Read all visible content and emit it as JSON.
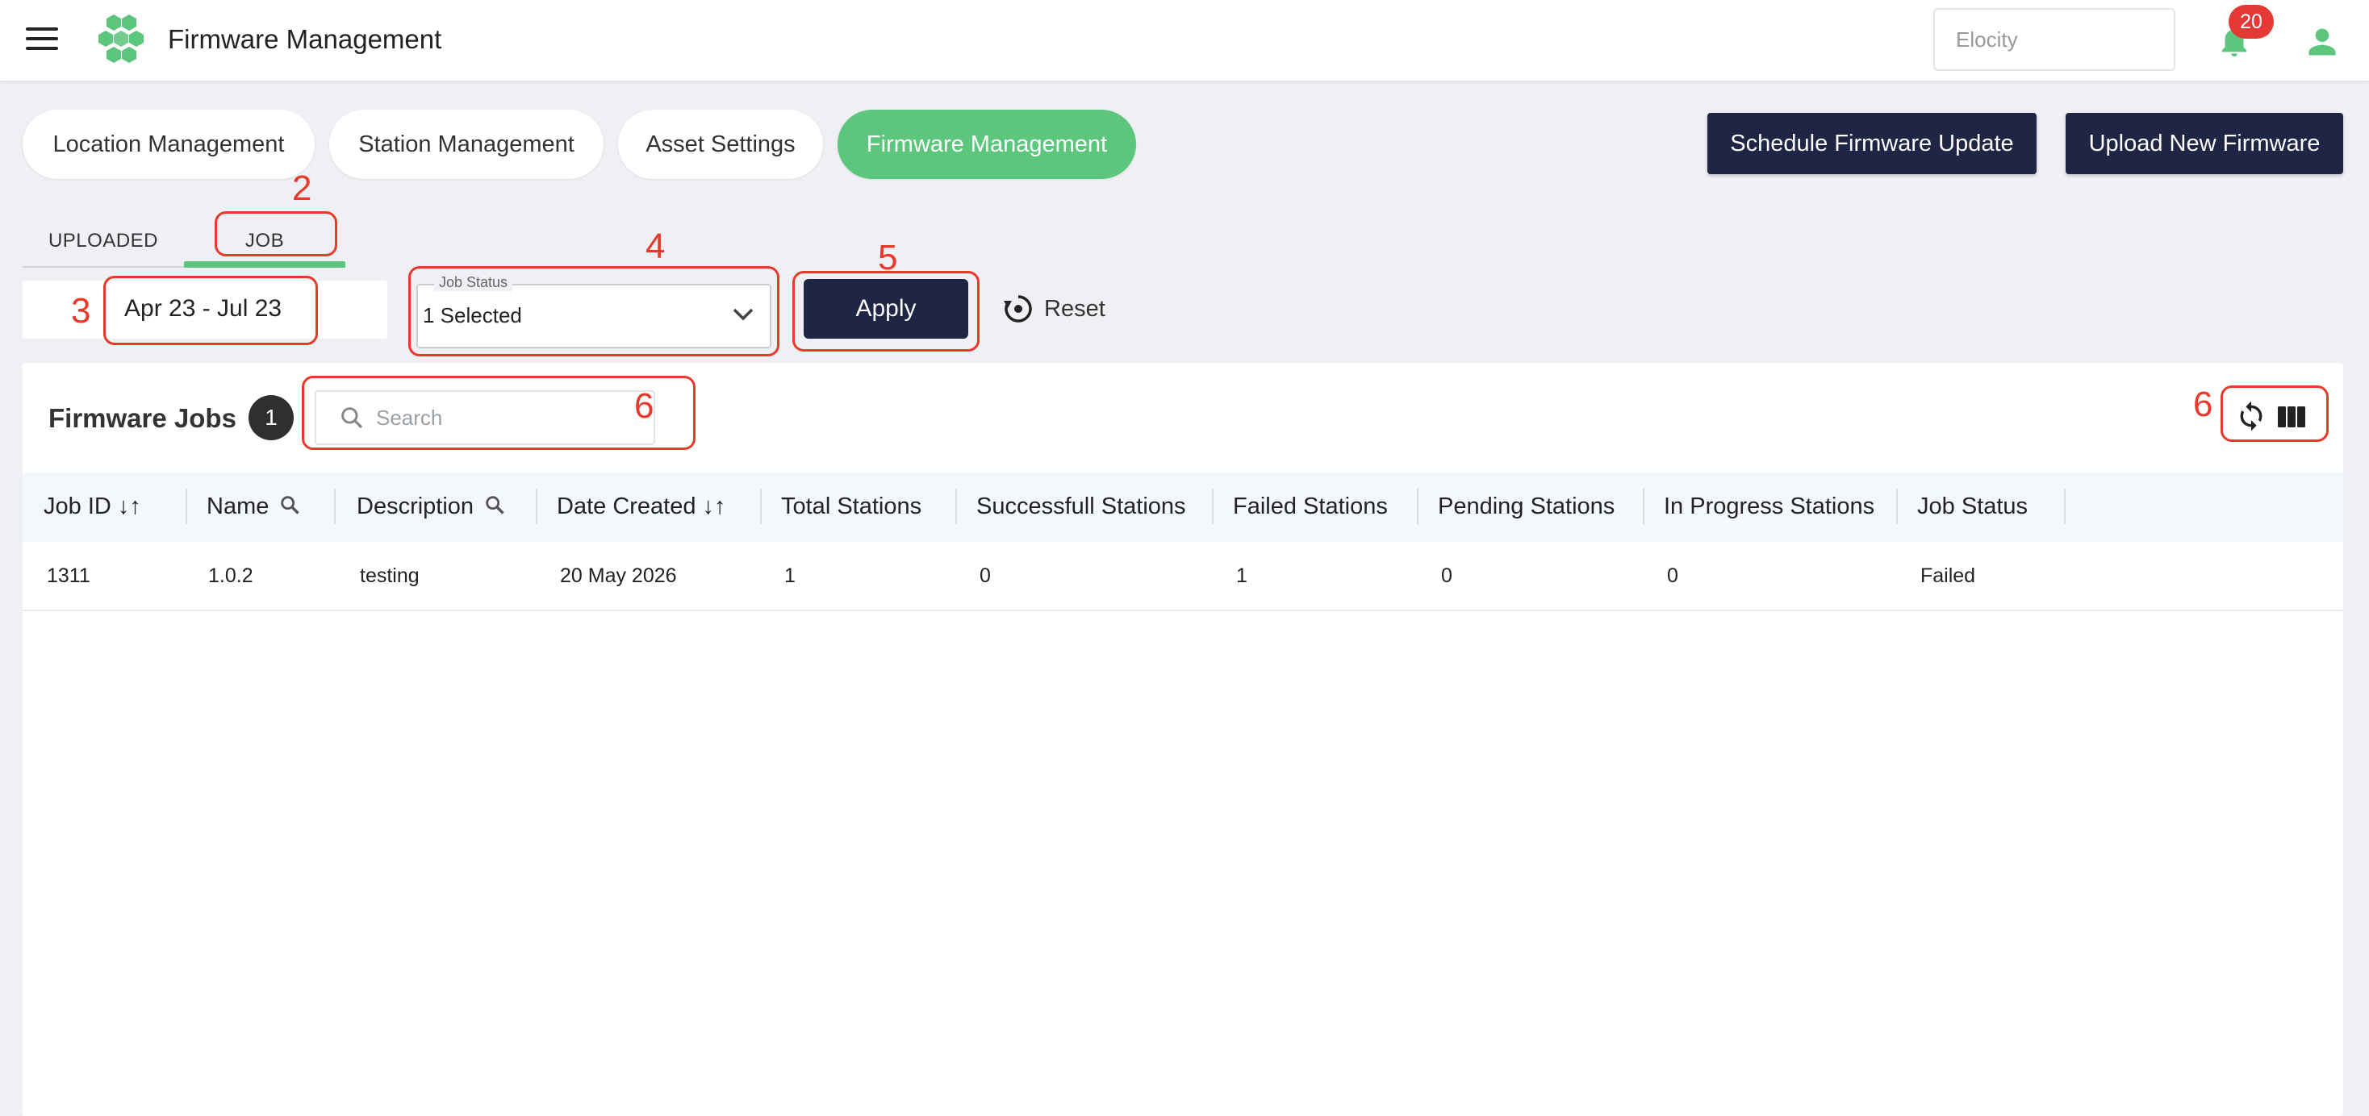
{
  "header": {
    "title": "Firmware Management",
    "search_value": "Elocity",
    "notifications_count": "20"
  },
  "nav": {
    "pills": [
      {
        "label": "Location Management",
        "active": false
      },
      {
        "label": "Station Management",
        "active": false
      },
      {
        "label": "Asset Settings",
        "active": false
      },
      {
        "label": "Firmware Management",
        "active": true
      }
    ],
    "schedule_label": "Schedule Firmware Update",
    "upload_label": "Upload New Firmware"
  },
  "tabs": [
    {
      "label": "UPLOADED",
      "active": false
    },
    {
      "label": "JOB",
      "active": true
    }
  ],
  "filters": {
    "date_range": "Apr 23 - Jul 23",
    "job_status_label": "Job Status",
    "job_status_value": "1 Selected",
    "apply_label": "Apply",
    "reset_label": "Reset"
  },
  "card": {
    "title": "Firmware Jobs",
    "count": "1",
    "search_placeholder": "Search"
  },
  "table": {
    "columns": [
      "Job ID ↓↑",
      "Name",
      "Description",
      "Date Created ↓↑",
      "Total Stations",
      "Successfull Stations",
      "Failed Stations",
      "Pending Stations",
      "In Progress Stations",
      "Job Status"
    ],
    "rows": [
      [
        "1311",
        "1.0.2",
        "testing",
        "20 May 2026",
        "1",
        "0",
        "1",
        "0",
        "0",
        "Failed"
      ]
    ]
  },
  "annotations": [
    "2",
    "3",
    "4",
    "5",
    "6",
    "6"
  ],
  "colors": {
    "accent": "#5bc67c",
    "dark_button": "#1f2544",
    "badge": "#e53935",
    "annotation": "#e8392a"
  }
}
